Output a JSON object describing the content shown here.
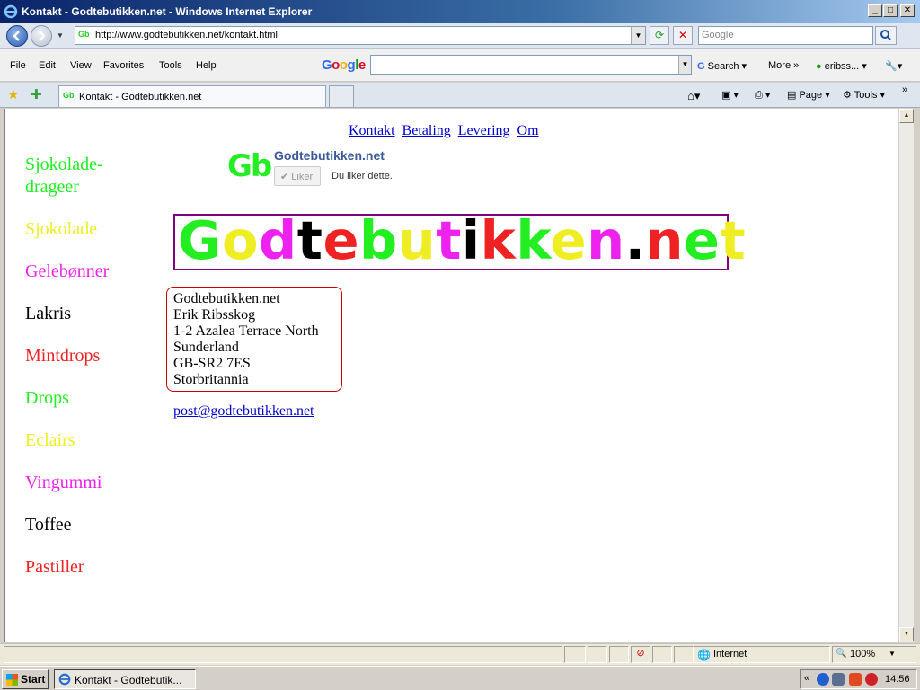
{
  "window": {
    "title": "Kontakt - Godtebutikken.net - Windows Internet Explorer",
    "minimize": "_",
    "maximize": "□",
    "close": "✕"
  },
  "address_bar": {
    "url": "http://www.godtebutikken.net/kontakt.html",
    "search_placeholder": "Google",
    "favicon": "Gb"
  },
  "menu": {
    "items": [
      "File",
      "Edit",
      "View",
      "Favorites",
      "Tools",
      "Help"
    ],
    "google_logo": "Google",
    "search_button": "Search",
    "more_button": "More »",
    "user": "eribss..."
  },
  "tabs": {
    "active_label": "Kontakt - Godtebutikken.net",
    "favicon": "Gb"
  },
  "command_bar": {
    "page": "Page",
    "tools": "Tools"
  },
  "page": {
    "top_nav": [
      "Kontakt",
      "Betaling",
      "Levering",
      "Om"
    ],
    "categories": [
      {
        "label": "Sjokolade-",
        "color": "#22ee22"
      },
      {
        "label": "drageer",
        "color": "#22ee22"
      },
      {
        "label": "Sjokolade",
        "color": "#eeee22"
      },
      {
        "label": "Gelebønner",
        "color": "#ee22ee"
      },
      {
        "label": "Lakris",
        "color": "#000000"
      },
      {
        "label": "Mintdrops",
        "color": "#ee2222"
      },
      {
        "label": "Drops",
        "color": "#22ee22"
      },
      {
        "label": "Eclairs",
        "color": "#eeee22"
      },
      {
        "label": "Vingummi",
        "color": "#ee22ee"
      },
      {
        "label": "Toffee",
        "color": "#000000"
      },
      {
        "label": "Pastiller",
        "color": "#ee2222"
      }
    ],
    "facebook": {
      "logo": "Gb",
      "name": "Godtebutikken.net",
      "like_button": "✔ Liker",
      "like_text": "Du liker dette."
    },
    "banner": {
      "letters": [
        "G",
        "o",
        "d",
        "t",
        "e",
        "b",
        "u",
        "t",
        "i",
        "k",
        "k",
        "e",
        "n",
        ".",
        "n",
        "e",
        "t"
      ],
      "colors": [
        "#22ee22",
        "#eeee22",
        "#ee22ee",
        "#000000",
        "#ee2222",
        "#22ee22",
        "#eeee22",
        "#ee22ee",
        "#000000",
        "#ee2222",
        "#22ee22",
        "#eeee22",
        "#ee22ee",
        "#000000",
        "#ee2222",
        "#22ee22",
        "#eeee22"
      ]
    },
    "address": [
      "Godtebutikken.net",
      "Erik Ribsskog",
      "1-2 Azalea Terrace North",
      "Sunderland",
      "GB-SR2 7ES",
      "Storbritannia"
    ],
    "email": "post@godtebutikken.net"
  },
  "status_bar": {
    "zone": "Internet",
    "zoom": "100%"
  },
  "taskbar": {
    "start": "Start",
    "task": "Kontakt - Godtebutik...",
    "clock": "14:56"
  }
}
